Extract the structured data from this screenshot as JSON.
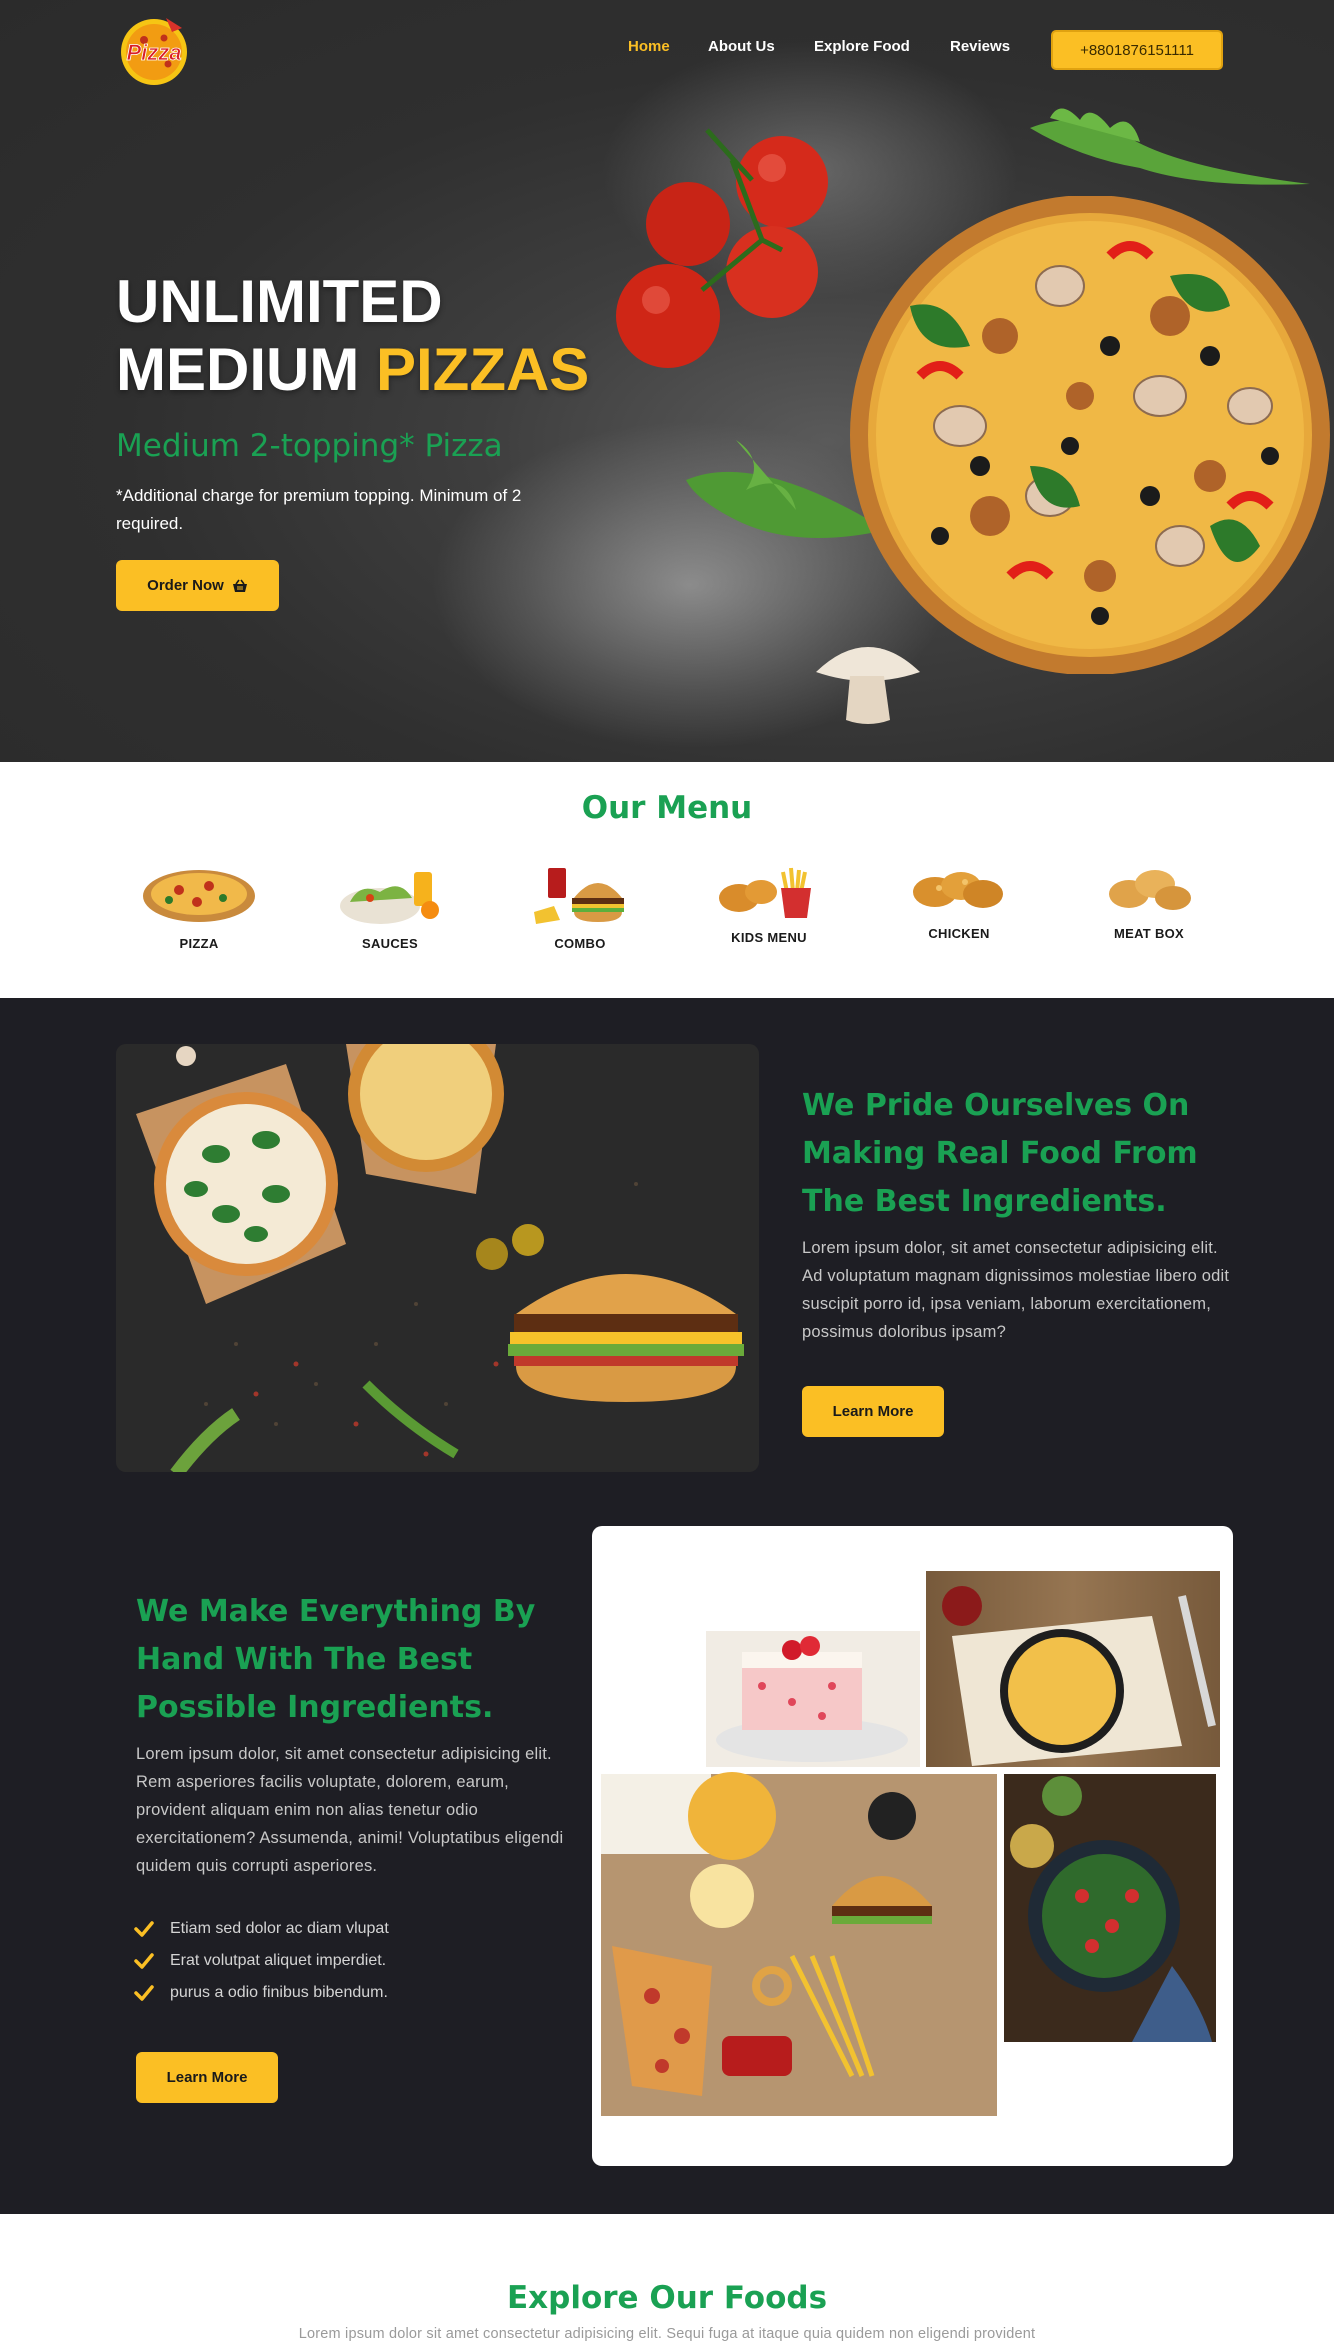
{
  "brand": {
    "logo_text": "Pizza"
  },
  "nav": {
    "items": [
      {
        "label": "Home",
        "active": true
      },
      {
        "label": "About Us",
        "active": false
      },
      {
        "label": "Explore Food",
        "active": false
      },
      {
        "label": "Reviews",
        "active": false
      }
    ],
    "phone": "+8801876151111"
  },
  "hero": {
    "title_line1": "UNLIMITED",
    "title_line2_white": "MEDIUM",
    "title_line2_accent": "PIZZAS",
    "subtitle": "Medium 2-topping* Pizza",
    "note": "*Additional charge for premium topping. Minimum of 2 required.",
    "cta_label": "Order Now"
  },
  "menu": {
    "title": "Our Menu",
    "items": [
      {
        "label": "PIZZA",
        "icon": "pizza-icon"
      },
      {
        "label": "SAUCES",
        "icon": "sauces-icon"
      },
      {
        "label": "COMBO",
        "icon": "combo-icon"
      },
      {
        "label": "KIDS MENU",
        "icon": "kids-menu-icon"
      },
      {
        "label": "CHICKEN",
        "icon": "chicken-icon"
      },
      {
        "label": "MEAT BOX",
        "icon": "meat-box-icon"
      }
    ]
  },
  "pride": {
    "heading": "We Pride Ourselves On Making Real Food From The Best Ingredients.",
    "body": "Lorem ipsum dolor, sit amet consectetur adipisicing elit. Ad voluptatum magnam dignissimos molestiae libero odit suscipit porro id, ipsa veniam, laborum exercitationem, possimus doloribus ipsam?",
    "cta_label": "Learn More"
  },
  "handmade": {
    "heading": "We Make Everything By Hand With The Best Possible Ingredients.",
    "body": "Lorem ipsum dolor, sit amet consectetur adipisicing elit. Rem asperiores facilis voluptate, dolorem, earum, provident aliquam enim non alias tenetur odio exercitationem? Assumenda, animi! Voluptatibus eligendi quidem quis corrupti asperiores.",
    "checklist": [
      "Etiam sed dolor ac diam vlupat",
      "Erat volutpat aliquet imperdiet.",
      "purus a odio finibus bibendum."
    ],
    "cta_label": "Learn More"
  },
  "explore": {
    "title": "Explore Our Foods",
    "subtitle": "Lorem ipsum dolor sit amet consectetur adipisicing elit. Sequi fuga at itaque quia quidem non eligendi provident"
  },
  "colors": {
    "accent_yellow": "#fbbf24",
    "brand_green": "#1aa153",
    "dark_bg": "#1e1e24",
    "hero_bg": "#2f2f2f"
  }
}
